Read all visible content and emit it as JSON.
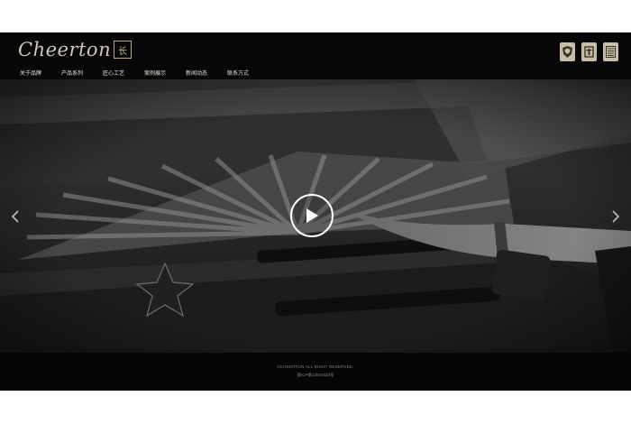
{
  "brand": {
    "script_name": "Cheerton",
    "mark_text": "长"
  },
  "header_badges": [
    {
      "name": "crest-badge-1",
      "icon": "shield-crest-icon"
    },
    {
      "name": "crest-badge-2",
      "icon": "crown-crest-icon"
    },
    {
      "name": "crest-badge-3",
      "icon": "monogram-crest-icon"
    }
  ],
  "nav": {
    "items": [
      {
        "label": "关于品牌"
      },
      {
        "label": "产品系列"
      },
      {
        "label": "匠心工艺"
      },
      {
        "label": "案例展示"
      },
      {
        "label": "新闻动态"
      },
      {
        "label": "联系方式"
      }
    ]
  },
  "hero": {
    "play_icon": "play-icon",
    "prev_icon": "chevron-left-icon",
    "next_icon": "chevron-right-icon"
  },
  "footer": {
    "copyright": "©CHEERTON ALL RIGHT RESERVED.",
    "icp": "备ICP备13018433号"
  },
  "colors": {
    "page_bg": "#ffffff",
    "site_bg": "#050505",
    "nav_text": "#e8e2d6",
    "badge": "#c7bda8",
    "footer_text": "#8a8378"
  }
}
